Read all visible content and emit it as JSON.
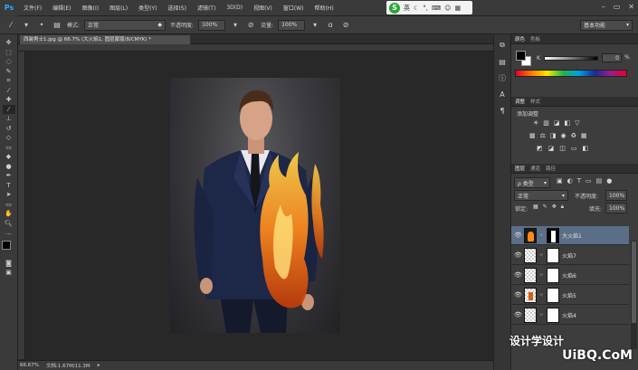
{
  "app": {
    "logo": "Ps"
  },
  "menu": [
    "文件(F)",
    "编辑(E)",
    "图像(I)",
    "图层(L)",
    "类型(Y)",
    "选择(S)",
    "滤镜(T)",
    "3D(D)",
    "视图(V)",
    "窗口(W)",
    "帮助(H)"
  ],
  "ime": {
    "label": "英"
  },
  "options": {
    "mode_label": "模式:",
    "mode_value": "正常",
    "opacity_label": "不透明度:",
    "opacity_value": "100%",
    "flow_label": "流量:",
    "flow_value": "100%",
    "workspace": "基本功能"
  },
  "document": {
    "tab_title": "西装男士1.jpg @ 66.7% (大火焰1, 图层蒙版/8/CMYK) *",
    "zoom": "66.67%",
    "doc_info": "文档:1.67M/11.3M"
  },
  "panels": {
    "color_tabs": [
      "颜色",
      "色板"
    ],
    "color_value": "0",
    "color_unit": "%",
    "adjust_tabs": [
      "调整",
      "样式"
    ],
    "adjust_title": "添加调整",
    "layers_tabs": [
      "图层",
      "通道",
      "路径"
    ],
    "kind_filter": "ρ 类型",
    "blend_mode": "正常",
    "opacity_label": "不透明度:",
    "opacity_value": "100%",
    "lock_label": "锁定:",
    "fill_label": "填充:",
    "fill_value": "100%",
    "layers": [
      {
        "name": "大火焰1",
        "selected": true
      },
      {
        "name": "火焰7",
        "selected": false
      },
      {
        "name": "火焰6",
        "selected": false
      },
      {
        "name": "火焰5",
        "selected": false
      },
      {
        "name": "火焰4",
        "selected": false
      }
    ]
  },
  "watermark": {
    "text1": "设计学设计",
    "text2": "UiBQ.CoM"
  },
  "colors": {
    "accent": "#31a8ff",
    "selected_layer": "#5a6e87",
    "bg": "#282828"
  }
}
